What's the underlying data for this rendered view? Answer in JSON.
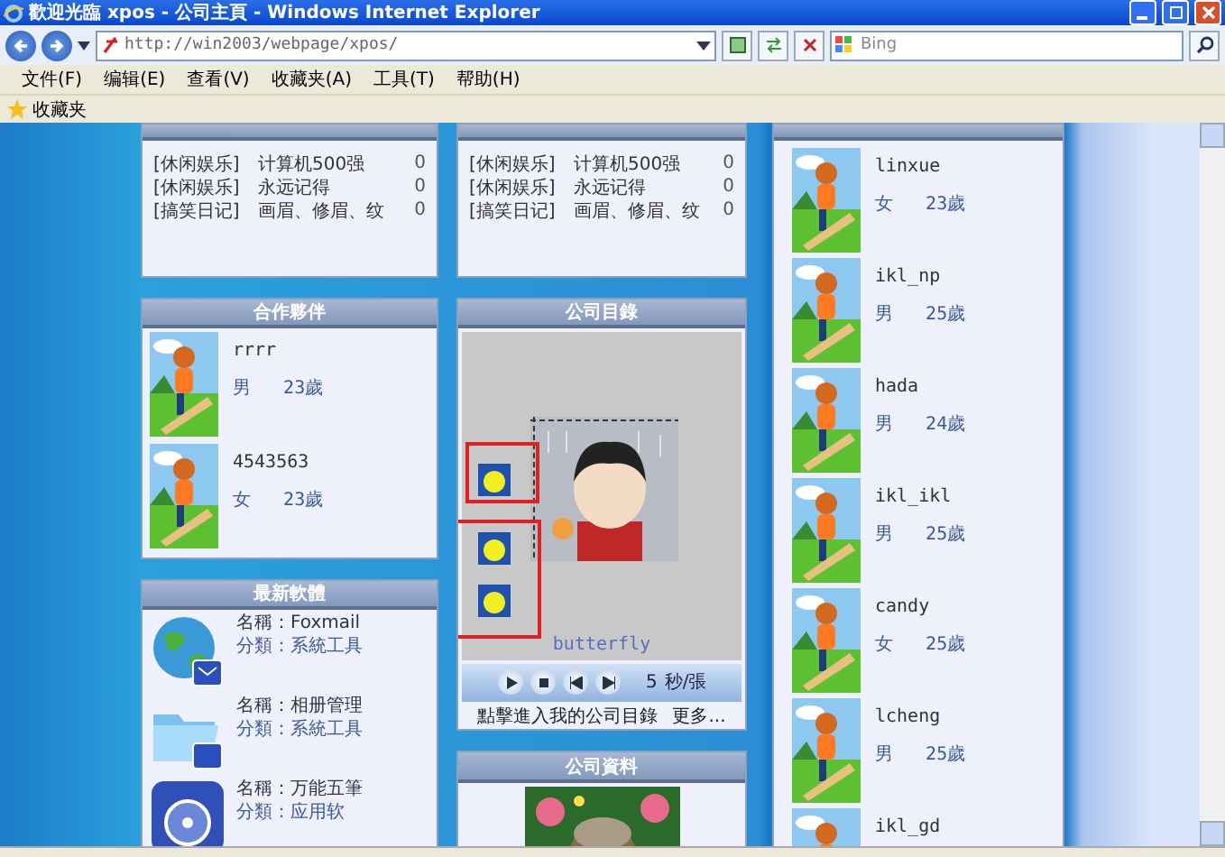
{
  "window": {
    "title": "歡迎光臨 xpos - 公司主頁 - Windows Internet Explorer"
  },
  "address_bar": {
    "url": "http://win2003/webpage/xpos/"
  },
  "search": {
    "placeholder": "Bing"
  },
  "menu": [
    "文件(F)",
    "编辑(E)",
    "查看(V)",
    "收藏夹(A)",
    "工具(T)",
    "帮助(H)"
  ],
  "favorites": {
    "label": "收藏夹"
  },
  "latest_topics": {
    "rows": [
      {
        "category": "[休闲娱乐]",
        "title": "计算机500强",
        "count": "0"
      },
      {
        "category": "[休闲娱乐]",
        "title": "永远记得",
        "count": "0"
      },
      {
        "category": "[搞笑日记]",
        "title": "画眉、修眉、纹",
        "count": "0"
      }
    ]
  },
  "latest_replies": {
    "rows": [
      {
        "category": "[休闲娱乐]",
        "title": "计算机500强",
        "count": "0"
      },
      {
        "category": "[休闲娱乐]",
        "title": "永远记得",
        "count": "0"
      },
      {
        "category": "[搞笑日记]",
        "title": "画眉、修眉、纹",
        "count": "0"
      }
    ]
  },
  "partners": {
    "title": "合作夥伴",
    "members": [
      {
        "name": "rrrr",
        "gender": "男",
        "age": "23歲"
      },
      {
        "name": "4543563",
        "gender": "女",
        "age": "23歲"
      }
    ]
  },
  "catalog": {
    "title": "公司目錄",
    "caption": "butterfly",
    "interval": "5",
    "unit": "秒/張",
    "footer_link": "點擊進入我的公司目錄",
    "more": "更多..."
  },
  "software": {
    "title": "最新軟體",
    "items": [
      {
        "name": "名稱：Foxmail",
        "category": "分類：系統工具",
        "kind": "globe"
      },
      {
        "name": "名稱：相册管理",
        "category": "分類：系統工具",
        "kind": "folder"
      },
      {
        "name": "名稱：万能五筆",
        "category": "分類：应用软",
        "kind": "app"
      }
    ]
  },
  "company_info": {
    "title": "公司資料"
  },
  "visitors": [
    {
      "name": "linxue",
      "gender": "女",
      "age": "23歲"
    },
    {
      "name": "ikl_np",
      "gender": "男",
      "age": "25歲"
    },
    {
      "name": "hada",
      "gender": "男",
      "age": "24歲"
    },
    {
      "name": "ikl_ikl",
      "gender": "男",
      "age": "25歲"
    },
    {
      "name": "candy",
      "gender": "女",
      "age": "25歲"
    },
    {
      "name": "lcheng",
      "gender": "男",
      "age": "25歲"
    },
    {
      "name": "ikl_gd"
    }
  ]
}
